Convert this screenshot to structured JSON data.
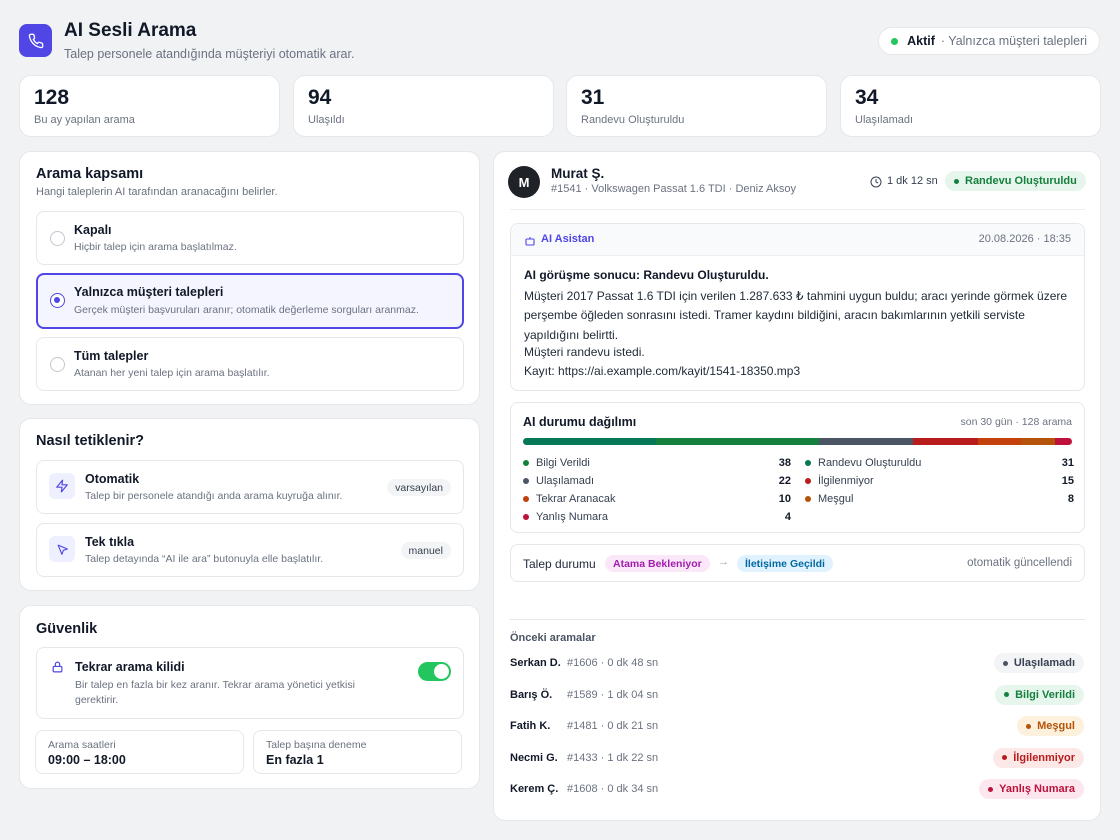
{
  "header": {
    "title": "AI Sesli Arama",
    "subtitle": "Talep personele atandığında müşteriyi otomatik arar.",
    "status_active": "Aktif",
    "status_scope": "· Yalnızca müşteri talepleri"
  },
  "stats": [
    {
      "value": "128",
      "label": "Bu ay yapılan arama"
    },
    {
      "value": "94",
      "label": "Ulaşıldı"
    },
    {
      "value": "31",
      "label": "Randevu Oluşturuldu"
    },
    {
      "value": "34",
      "label": "Ulaşılamadı"
    }
  ],
  "scope": {
    "title": "Arama kapsamı",
    "subtitle": "Hangi taleplerin AI tarafından aranacağını belirler.",
    "options": [
      {
        "title": "Kapalı",
        "desc": "Hiçbir talep için arama başlatılmaz.",
        "selected": false
      },
      {
        "title": "Yalnızca müşteri talepleri",
        "desc": "Gerçek müşteri başvuruları aranır; otomatik değerleme sorguları aranmaz.",
        "selected": true
      },
      {
        "title": "Tüm talepler",
        "desc": "Atanan her yeni talep için arama başlatılır.",
        "selected": false
      }
    ]
  },
  "trigger": {
    "title": "Nasıl tetiklenir?",
    "items": [
      {
        "title": "Otomatik",
        "desc": "Talep bir personele atandığı anda arama kuyruğa alınır.",
        "tag": "varsayılan",
        "icon": "lightning-icon"
      },
      {
        "title": "Tek tıkla",
        "desc": "Talep detayında “AI ile ara” butonuyla elle başlatılır.",
        "tag": "manuel",
        "icon": "cursor-icon"
      }
    ]
  },
  "security": {
    "title": "Güvenlik",
    "lock_title": "Tekrar arama kilidi",
    "lock_desc": "Bir talep en fazla bir kez aranır. Tekrar arama yönetici yetkisi gerektirir.",
    "lock_enabled": true,
    "hours_label": "Arama saatleri",
    "hours_value": "09:00 – 18:00",
    "attempts_label": "Talep başına deneme",
    "attempts_value": "En fazla 1"
  },
  "call": {
    "avatar_initial": "M",
    "name": "Murat Ş.",
    "meta": "#1541 · Volkswagen Passat 1.6 TDI · Deniz Aksoy",
    "duration": "1 dk 12 sn",
    "status": "Randevu Oluşturuldu"
  },
  "assistant": {
    "label": "AI Asistan",
    "timestamp": "20.08.2026 · 18:35",
    "result_heading": "AI görüşme sonucu: Randevu Oluşturuldu.",
    "body": "Müşteri 2017 Passat 1.6 TDI için verilen 1.287.633 ₺ tahmini uygun buldu; aracı yerinde görmek üzere perşembe öğleden sonrasını istedi. Tramer kaydını bildiğini, aracın bakımlarının yetkili serviste yapıldığını belirtti.",
    "outcome": "Müşteri randevu istedi.",
    "recording": "Kayıt: https://ai.example.com/kayit/1541-18350.mp3"
  },
  "distribution": {
    "title": "AI durumu dağılımı",
    "meta": "son 30 gün · 128 arama",
    "legend_left": [
      {
        "label": "Bilgi Verildi",
        "value": "38",
        "color": "#15803d"
      },
      {
        "label": "Ulaşılamadı",
        "value": "22",
        "color": "#4b5563"
      },
      {
        "label": "Tekrar Aranacak",
        "value": "10",
        "color": "#c2410c"
      },
      {
        "label": "Yanlış Numara",
        "value": "4",
        "color": "#be123c"
      }
    ],
    "legend_right": [
      {
        "label": "Randevu Oluşturuldu",
        "value": "31",
        "color": "#047857"
      },
      {
        "label": "İlgilenmiyor",
        "value": "15",
        "color": "#b91c1c"
      },
      {
        "label": "Meşgul",
        "value": "8",
        "color": "#b45309"
      }
    ],
    "bar_segments": [
      {
        "name": "Randevu Oluşturuldu",
        "value": 31,
        "color": "#047857"
      },
      {
        "name": "Bilgi Verildi",
        "value": 38,
        "color": "#15803d"
      },
      {
        "name": "Ulaşılamadı",
        "value": 22,
        "color": "#4b5563"
      },
      {
        "name": "İlgilenmiyor",
        "value": 15,
        "color": "#b91c1c"
      },
      {
        "name": "Tekrar Aranacak",
        "value": 10,
        "color": "#c2410c"
      },
      {
        "name": "Meşgul",
        "value": 8,
        "color": "#b45309"
      },
      {
        "name": "Yanlış Numara",
        "value": 4,
        "color": "#be123c"
      }
    ]
  },
  "request_status": {
    "label": "Talep durumu",
    "from": "Atama Bekleniyor",
    "arrow": "→",
    "to": "İletişime Geçildi",
    "note": "otomatik güncellendi"
  },
  "history": {
    "title": "Önceki aramalar",
    "rows": [
      {
        "name": "Serkan D.",
        "meta": "#1606 · 0 dk 48 sn",
        "status": "Ulaşılamadı",
        "fg": "#374151",
        "bg": "#f3f4f6",
        "dot": "#4b5563"
      },
      {
        "name": "Barış Ö.",
        "meta": "#1589 · 1 dk 04 sn",
        "status": "Bilgi Verildi",
        "fg": "#15803d",
        "bg": "#e7f6ec",
        "dot": "#15803d"
      },
      {
        "name": "Fatih K.",
        "meta": "#1481 · 0 dk 21 sn",
        "status": "Meşgul",
        "fg": "#b45309",
        "bg": "#fdf0dc",
        "dot": "#b45309"
      },
      {
        "name": "Necmi G.",
        "meta": "#1433 · 1 dk 22 sn",
        "status": "İlgilenmiyor",
        "fg": "#b91c1c",
        "bg": "#fde8e8",
        "dot": "#b91c1c"
      },
      {
        "name": "Kerem Ç.",
        "meta": "#1608 · 0 dk 34 sn",
        "status": "Yanlış Numara",
        "fg": "#be123c",
        "bg": "#fde7ee",
        "dot": "#be123c"
      }
    ]
  },
  "colors": {
    "accent": "#4f46e5",
    "success": "#22c55e"
  }
}
